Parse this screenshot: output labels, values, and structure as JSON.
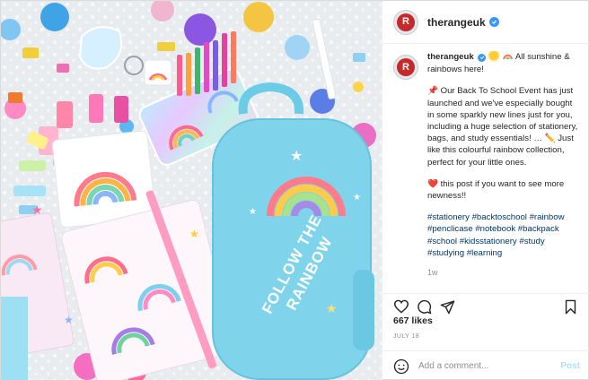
{
  "post": {
    "username": "therangeuk",
    "avatar_letter": "R",
    "caption_head": "All sunshine & rainbows here!",
    "paragraph1": "📌 Our Back To School Event has just launched and we've especially bought in some sparkly new lines just for you, including a huge selection of stationery, bags, and study essentials! … ✏️ Just like this colourful rainbow collection, perfect for your little ones.",
    "paragraph2": "❤️ this post if you want to see more newness!!",
    "hashtags": "#stationery #backtoschool #rainbow #penclicase #notebook #backpack #school #kidsstationery #study #studying #learning",
    "age": "1w",
    "likes": "667 likes",
    "date": "JULY 18"
  },
  "photo": {
    "backpack_text_line1": "FOLLOW THE",
    "backpack_text_line2": "RAINBOW"
  },
  "comment_box": {
    "placeholder": "Add a comment...",
    "post_label": "Post"
  },
  "colors": {
    "link": "#00376b",
    "verified": "#3897f0",
    "post_button_disabled": "#b2dffc",
    "backpack": "#7fd3ea"
  },
  "icons": [
    "verified-badge-icon",
    "heart-icon",
    "comment-icon",
    "share-icon",
    "bookmark-icon",
    "emoji-icon"
  ]
}
